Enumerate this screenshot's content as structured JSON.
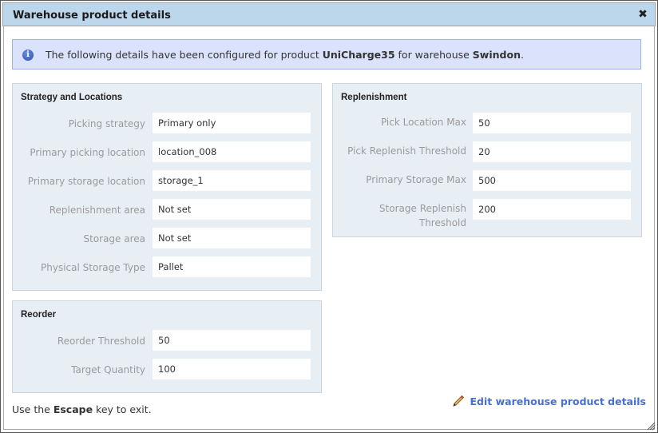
{
  "dialog": {
    "title": "Warehouse product details",
    "close_icon": "close-icon"
  },
  "info": {
    "icon": "info-icon",
    "prefix": "The following details have been configured for product ",
    "product": "UniCharge35",
    "middle": " for warehouse ",
    "warehouse": "Swindon",
    "suffix": "."
  },
  "strategy": {
    "title": "Strategy and Locations",
    "rows": [
      {
        "label": "Picking strategy",
        "value": "Primary only"
      },
      {
        "label": "Primary picking location",
        "value": "location_008"
      },
      {
        "label": "Primary storage location",
        "value": "storage_1"
      },
      {
        "label": "Replenishment area",
        "value": "Not set"
      },
      {
        "label": "Storage area",
        "value": "Not set"
      },
      {
        "label": "Physical Storage Type",
        "value": "Pallet"
      }
    ]
  },
  "reorder": {
    "title": "Reorder",
    "rows": [
      {
        "label": "Reorder Threshold",
        "value": "50"
      },
      {
        "label": "Target Quantity",
        "value": "100"
      }
    ]
  },
  "replenishment": {
    "title": "Replenishment",
    "rows": [
      {
        "label": "Pick Location Max",
        "value": "50"
      },
      {
        "label": "Pick Replenish Threshold",
        "value": "20"
      },
      {
        "label": "Primary Storage Max",
        "value": "500"
      },
      {
        "label": "Storage Replenish Threshold",
        "value": "200"
      }
    ]
  },
  "footer": {
    "hint_prefix": "Use the ",
    "hint_key": "Escape",
    "hint_suffix": " key to exit.",
    "edit_label": "Edit warehouse product details",
    "edit_icon": "pencil-icon"
  },
  "colors": {
    "titlebar": "#bcd6ec",
    "info_bg": "#dbe2fb",
    "panel_bg": "#e7eff5",
    "link": "#4a6fd4"
  }
}
